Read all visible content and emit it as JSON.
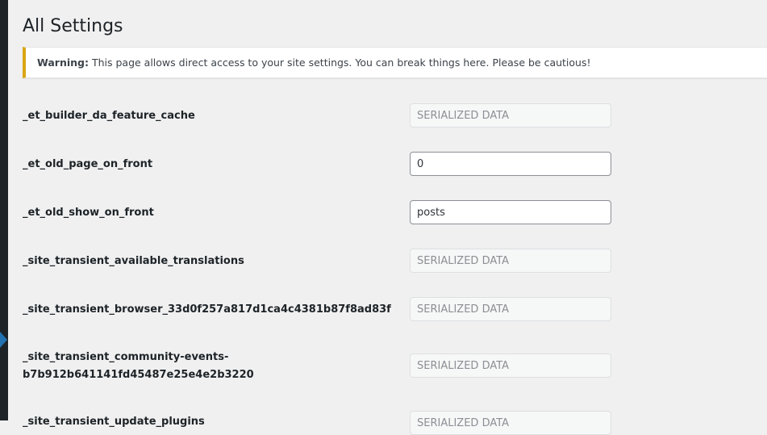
{
  "page": {
    "title": "All Settings"
  },
  "notice": {
    "strong": "Warning:",
    "text": " This page allows direct access to your site settings. You can break things here. Please be cautious!"
  },
  "settings": [
    {
      "name": "_et_builder_da_feature_cache",
      "value": "SERIALIZED DATA",
      "disabled": true
    },
    {
      "name": "_et_old_page_on_front",
      "value": "0",
      "disabled": false
    },
    {
      "name": "_et_old_show_on_front",
      "value": "posts",
      "disabled": false
    },
    {
      "name": "_site_transient_available_translations",
      "value": "SERIALIZED DATA",
      "disabled": true
    },
    {
      "name": "_site_transient_browser_33d0f257a817d1ca4c4381b87f8ad83f",
      "value": "SERIALIZED DATA",
      "disabled": true
    },
    {
      "name": "_site_transient_community-events-",
      "name_line2": "b7b912b641141fd45487e25e4e2b3220",
      "value": "SERIALIZED DATA",
      "disabled": true
    },
    {
      "name": "_site_transient_update_plugins",
      "value": "SERIALIZED DATA",
      "disabled": true
    }
  ],
  "colors": {
    "notice_border": "#dba617",
    "background": "#f0f0f1",
    "admin_sidebar": "#1d2327",
    "active_menu": "#2271b1"
  }
}
